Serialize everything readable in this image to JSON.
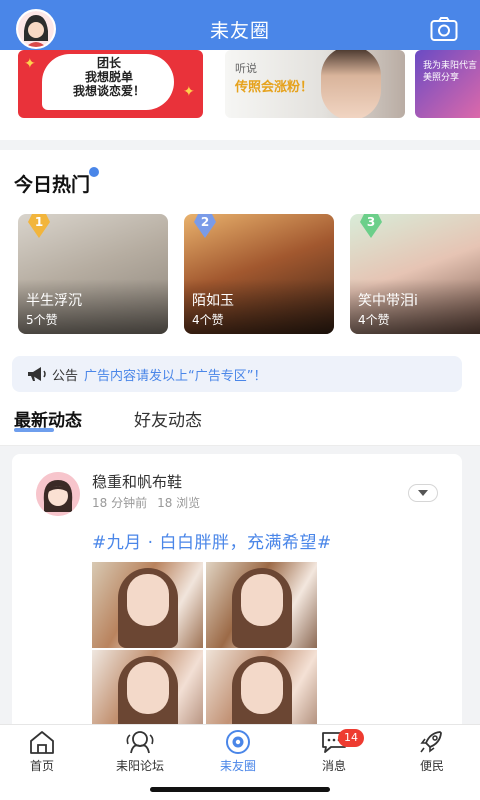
{
  "header": {
    "title": "耒友圈",
    "avatar_icon": "user-avatar-icon",
    "camera_icon": "camera-icon",
    "color": "#4a86e8"
  },
  "banners": [
    {
      "text_lines": [
        "团长",
        "我想脱单",
        "我想谈恋爱！"
      ]
    },
    {
      "line1": "听说",
      "line2": "传照会涨粉！"
    },
    {
      "lines": [
        "我为耒阳代言",
        "美照分享"
      ]
    }
  ],
  "hot": {
    "title": "今日热门",
    "cards": [
      {
        "rank": "1",
        "name": "半生浮沉",
        "likes": "5个赞",
        "rank_color": "#f2b53c"
      },
      {
        "rank": "2",
        "name": "陌如玉",
        "likes": "4个赞",
        "rank_color": "#7a9be8"
      },
      {
        "rank": "3",
        "name": "笑中带泪i",
        "likes": "4个赞",
        "rank_color": "#6ccf8a"
      }
    ]
  },
  "notice": {
    "label": "公告",
    "text": "广告内容请发以上“广告专区”！",
    "icon": "megaphone-icon"
  },
  "tabs": {
    "latest": "最新动态",
    "friends": "好友动态"
  },
  "post": {
    "user": "稳重和帆布鞋",
    "time": "18 分钟前",
    "views": "18 浏览",
    "topic": "#九月 · 白白胖胖，充满希望#",
    "photo_count": 4
  },
  "bottom_nav": {
    "items": [
      {
        "label": "首页",
        "icon": "home-icon"
      },
      {
        "label": "耒阳论坛",
        "icon": "forum-icon"
      },
      {
        "label": "耒友圈",
        "icon": "moments-icon",
        "active": true
      },
      {
        "label": "消息",
        "icon": "message-icon",
        "badge": "14"
      },
      {
        "label": "便民",
        "icon": "rocket-icon"
      }
    ],
    "active_color": "#4a86e8",
    "badge_color": "#ee3b30"
  }
}
